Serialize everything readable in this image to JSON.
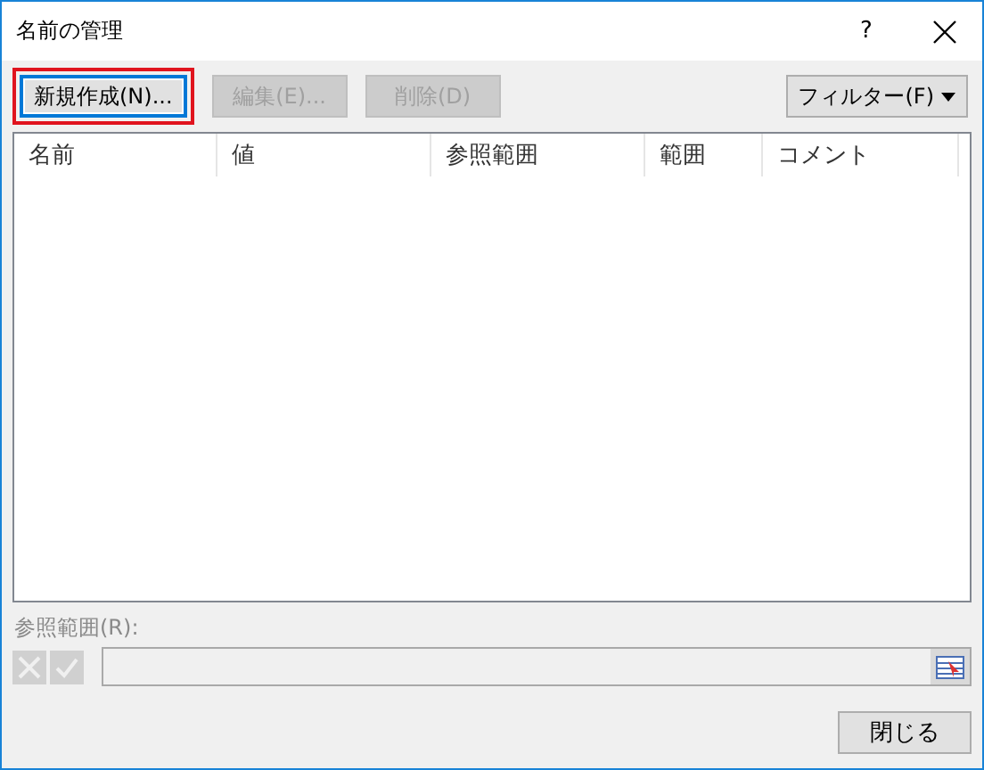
{
  "window": {
    "title": "名前の管理",
    "help": "?"
  },
  "toolbar": {
    "buttons": [
      {
        "label": "新規作成(N)...",
        "disabled": false,
        "focused": true,
        "highlighted": true
      },
      {
        "label": "編集(E)...",
        "disabled": true,
        "focused": false,
        "highlighted": false
      },
      {
        "label": "削除(D)",
        "disabled": true,
        "focused": false,
        "highlighted": false
      }
    ],
    "filter": {
      "label": "フィルター(F)"
    }
  },
  "table": {
    "columns": [
      "名前",
      "値",
      "参照範囲",
      "範囲",
      "コメント"
    ]
  },
  "reference": {
    "label": "参照範囲(R):",
    "cancel_disabled": true,
    "confirm_disabled": true
  },
  "buttons": [
    "閉じる"
  ]
}
